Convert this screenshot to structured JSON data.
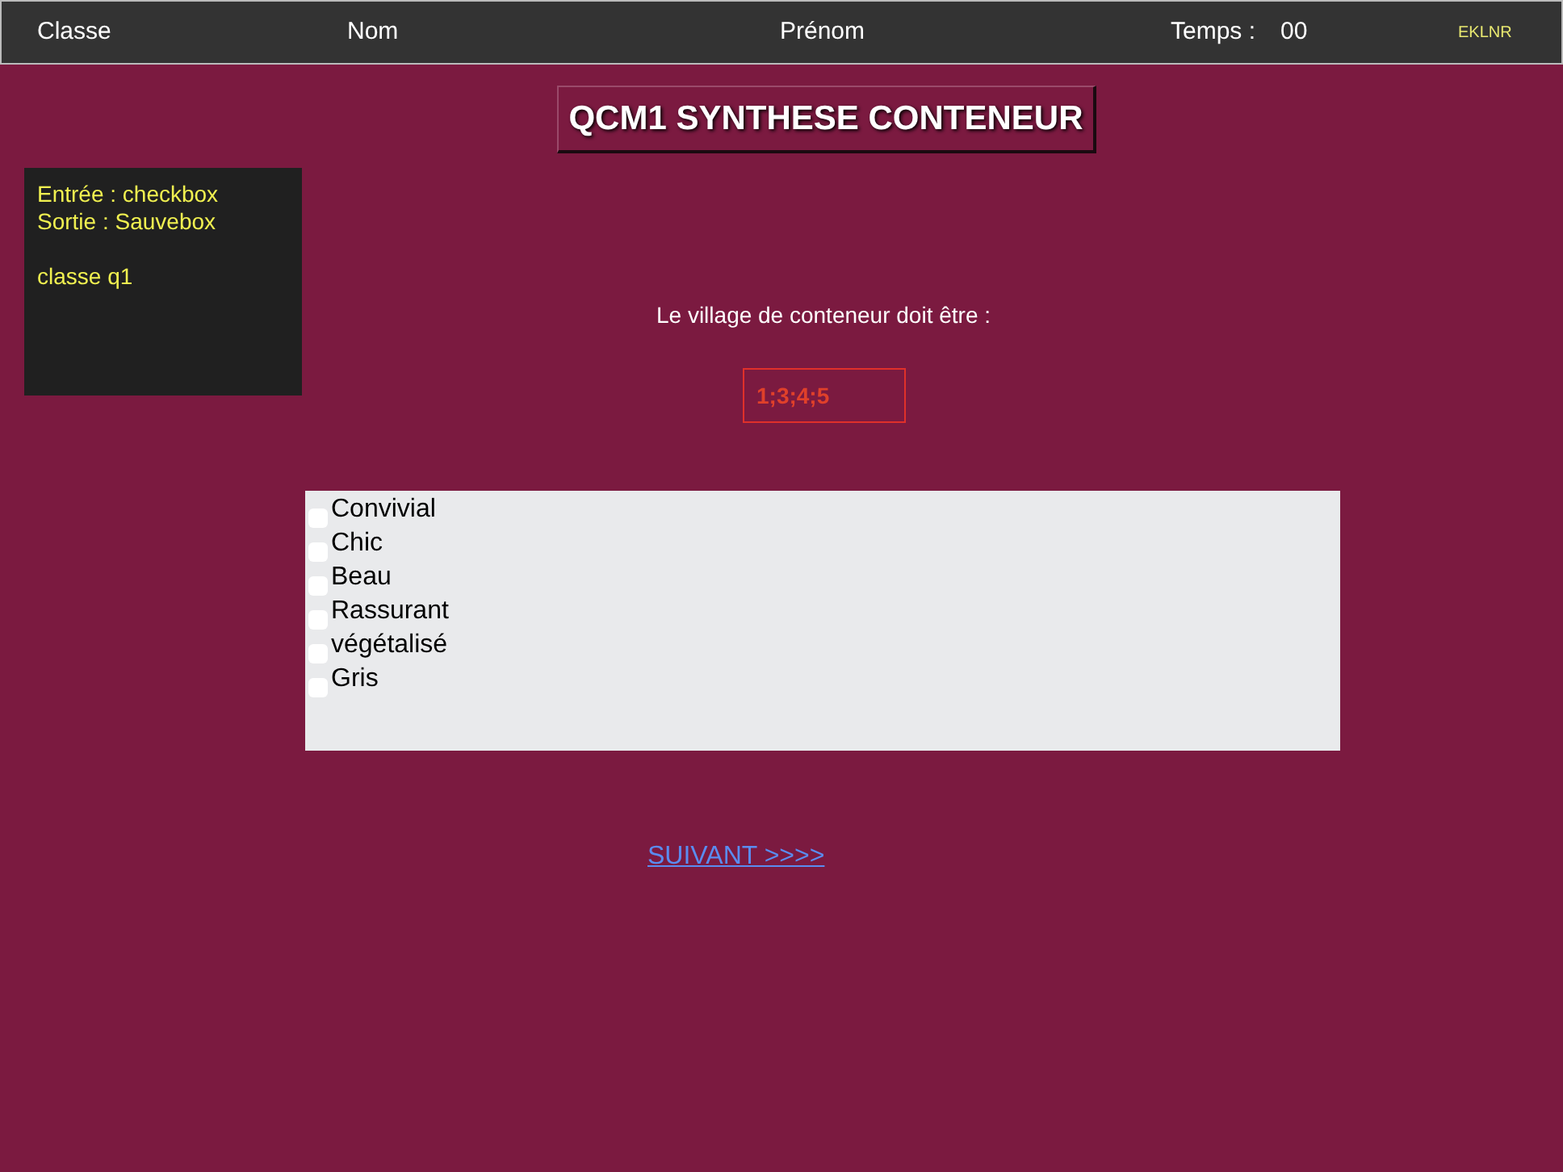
{
  "header": {
    "fields": [
      "Classe",
      "Nom",
      "Prénom"
    ],
    "timer_label": "Temps :",
    "timer_value": "00",
    "code": "EKLNR"
  },
  "title": "QCM1 SYNTHESE CONTENEUR",
  "info_box": {
    "lines": [
      "Entrée : checkbox",
      "Sortie : Sauvebox"
    ],
    "class_line": "classe q1"
  },
  "question": "Le village de conteneur doit être :",
  "answer": "1;3;4;5",
  "options": [
    {
      "label": "Convivial",
      "checked": false
    },
    {
      "label": "Chic",
      "checked": false
    },
    {
      "label": "Beau",
      "checked": false
    },
    {
      "label": "Rassurant",
      "checked": false
    },
    {
      "label": "végétalisé",
      "checked": false
    },
    {
      "label": "Gris",
      "checked": false
    }
  ],
  "next_link": "SUIVANT >>>>"
}
